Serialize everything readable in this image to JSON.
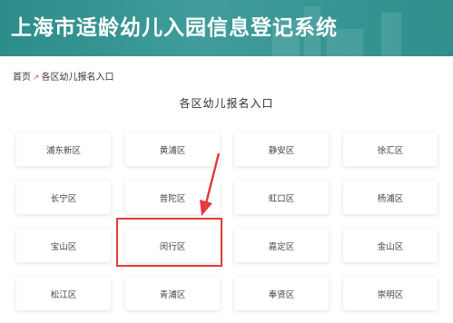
{
  "header": {
    "title": "上海市适龄幼儿入园信息登记系统",
    "bg_color": "#2c8d8b"
  },
  "breadcrumb": {
    "home": "首页",
    "separator_icon": "arrow-icon",
    "current": "各区幼儿报名入口"
  },
  "section_title": "各区幼儿报名入口",
  "districts": [
    "浦东新区",
    "黄浦区",
    "静安区",
    "徐汇区",
    "长宁区",
    "普陀区",
    "虹口区",
    "杨浦区",
    "宝山区",
    "闵行区",
    "嘉定区",
    "金山区",
    "松江区",
    "青浦区",
    "奉贤区",
    "崇明区"
  ],
  "annotation": {
    "highlighted_district": "闵行区",
    "color": "#e53b3b"
  }
}
